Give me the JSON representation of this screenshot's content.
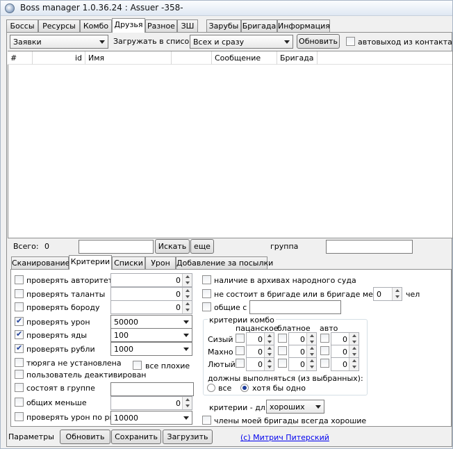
{
  "window": {
    "title": "Boss manager 1.0.36.24 : Assuer -358-"
  },
  "main_tabs": [
    "Боссы",
    "Ресурсы",
    "Комбо",
    "Друзья",
    "Разное",
    "ЗШ",
    "Зарубы",
    "Бригада",
    "Информация"
  ],
  "main_tab_active": "Друзья",
  "toolbar": {
    "list_type_value": "Заявки",
    "load_into_label": "Загружать в список:",
    "load_mode_value": "Всех и сразу",
    "refresh_label": "Обновить",
    "autoexit_label": "автовыход из контакта"
  },
  "grid": {
    "columns": [
      "#",
      "id",
      "Имя",
      "Сообщение",
      "Бригада"
    ]
  },
  "search": {
    "total_label": "Всего:",
    "total_value": "0",
    "search_value": "",
    "search_button": "Искать",
    "more_button": "еще",
    "group_label": "группа",
    "group_value": ""
  },
  "sub_tabs": [
    "Сканирование",
    "Критерии",
    "Списки",
    "Урон",
    "Добавление за посылки"
  ],
  "sub_tab_active": "Критерии",
  "criteria_left": {
    "authority": {
      "label": "проверять авторитет",
      "checked": false,
      "value": "0"
    },
    "talents": {
      "label": "проверять таланты",
      "checked": false,
      "value": "0"
    },
    "beard": {
      "label": "проверять бороду",
      "checked": false,
      "value": "0"
    },
    "damage": {
      "label": "проверять урон",
      "checked": true,
      "value": "50000"
    },
    "poisons": {
      "label": "проверять яды",
      "checked": true,
      "value": "100"
    },
    "rubles": {
      "label": "проверять рубли",
      "checked": true,
      "value": "1000"
    },
    "prison": {
      "label": "тюряга не установлена",
      "checked": false
    },
    "all_bad": {
      "label": "все плохие",
      "checked": false
    },
    "deactivated": {
      "label": "пользователь деактивирован",
      "checked": false
    },
    "in_group": {
      "label": "состоят в группе",
      "checked": false,
      "value": ""
    },
    "common_less": {
      "label": "общих меньше",
      "checked": false,
      "value": "0"
    },
    "damage_rsd": {
      "label": "проверять урон по рщд",
      "checked": false,
      "value": "10000"
    }
  },
  "criteria_right": {
    "archives": {
      "label": "наличие в архивах народного суда",
      "checked": false
    },
    "not_in_brigade": {
      "label": "не состоит в бригаде или в бригаде меньше",
      "checked": false,
      "value": "0",
      "unit": "чел"
    },
    "common_with": {
      "label": "общие с",
      "checked": false,
      "value": ""
    },
    "combo": {
      "title": "критерии комбо",
      "columns": [
        "пацанское",
        "блатное",
        "авто"
      ],
      "rows": [
        {
          "name": "Сизый",
          "values": [
            "0",
            "0",
            "0"
          ]
        },
        {
          "name": "Махно",
          "values": [
            "0",
            "0",
            "0"
          ]
        },
        {
          "name": "Лютый",
          "values": [
            "0",
            "0",
            "0"
          ]
        }
      ],
      "must_label": "должны выполняться (из выбранных):",
      "opt_all": "все",
      "opt_any": "хотя бы одно",
      "selected": "хотя бы одно"
    },
    "criteria_for_label": "критерии - для",
    "criteria_for_value": "хороших",
    "members_good": {
      "label": "члены моей бригады всегда хорошие",
      "checked": false
    }
  },
  "footer": {
    "params_label": "Параметры",
    "refresh": "Обновить",
    "save": "Сохранить",
    "load": "Загрузить",
    "copyright": "(c) Митрич Питерский"
  }
}
